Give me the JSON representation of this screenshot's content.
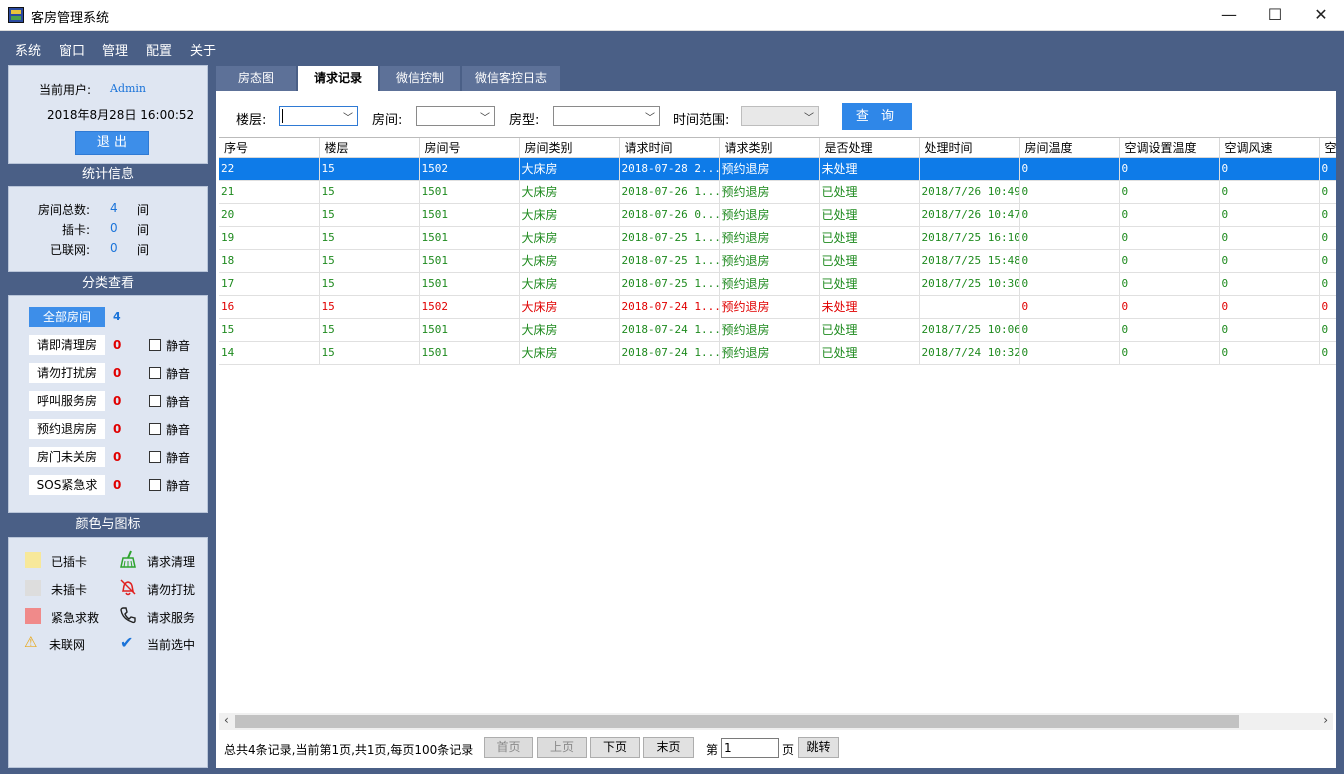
{
  "window": {
    "title": "客房管理系统",
    "minimize": "—",
    "maximize": "☐",
    "close": "✕"
  },
  "menu": [
    "系统",
    "窗口",
    "管理",
    "配置",
    "关于"
  ],
  "user_panel": {
    "label": "当前用户:",
    "user": "Admin",
    "datetime": "2018年8月28日 16:00:52",
    "logout": "退 出"
  },
  "stats": {
    "header": "统计信息",
    "rows": [
      {
        "label": "房间总数:",
        "value": "4",
        "unit": "间"
      },
      {
        "label": "插卡:",
        "value": "0",
        "unit": "间"
      },
      {
        "label": "已联网:",
        "value": "0",
        "unit": "间"
      }
    ]
  },
  "categories": {
    "header": "分类查看",
    "all": {
      "label": "全部房间",
      "count": "4"
    },
    "items": [
      {
        "label": "请即清理房",
        "count": "0",
        "mute": "静音"
      },
      {
        "label": "请勿打扰房",
        "count": "0",
        "mute": "静音"
      },
      {
        "label": "呼叫服务房",
        "count": "0",
        "mute": "静音"
      },
      {
        "label": "预约退房房",
        "count": "0",
        "mute": "静音"
      },
      {
        "label": "房门未关房",
        "count": "0",
        "mute": "静音"
      },
      {
        "label": "SOS紧急求",
        "count": "0",
        "mute": "静音"
      }
    ]
  },
  "legend": {
    "header": "颜色与图标",
    "left": [
      "已插卡",
      "未插卡",
      "紧急求救",
      "未联网"
    ],
    "right": [
      "请求清理",
      "请勿打扰",
      "请求服务",
      "当前选中"
    ],
    "colors": {
      "inserted": "#f7e89a",
      "not_inserted": "#dddddd",
      "emergency": "#f08a8a"
    }
  },
  "tabs": [
    "房态图",
    "请求记录",
    "微信控制",
    "微信客控日志"
  ],
  "filters": {
    "floor": "楼层:",
    "room": "房间:",
    "room_type": "房型:",
    "time_range": "时间范围:",
    "query": "查 询"
  },
  "table": {
    "columns": [
      "序号",
      "楼层",
      "房间号",
      "房间类别",
      "请求时间",
      "请求类别",
      "是否处理",
      "处理时间",
      "房间温度",
      "空调设置温度",
      "空调风速",
      "空"
    ],
    "rows": [
      [
        "22",
        "15",
        "1502",
        "大床房",
        "2018-07-28 2...",
        "预约退房",
        "未处理",
        "",
        "0",
        "0",
        "0",
        "0"
      ],
      [
        "21",
        "15",
        "1501",
        "大床房",
        "2018-07-26 1...",
        "预约退房",
        "已处理",
        "2018/7/26 10:49",
        "0",
        "0",
        "0",
        "0"
      ],
      [
        "20",
        "15",
        "1501",
        "大床房",
        "2018-07-26 0...",
        "预约退房",
        "已处理",
        "2018/7/26 10:47",
        "0",
        "0",
        "0",
        "0"
      ],
      [
        "19",
        "15",
        "1501",
        "大床房",
        "2018-07-25 1...",
        "预约退房",
        "已处理",
        "2018/7/25 16:10",
        "0",
        "0",
        "0",
        "0"
      ],
      [
        "18",
        "15",
        "1501",
        "大床房",
        "2018-07-25 1...",
        "预约退房",
        "已处理",
        "2018/7/25 15:48",
        "0",
        "0",
        "0",
        "0"
      ],
      [
        "17",
        "15",
        "1501",
        "大床房",
        "2018-07-25 1...",
        "预约退房",
        "已处理",
        "2018/7/25 10:30",
        "0",
        "0",
        "0",
        "0"
      ],
      [
        "16",
        "15",
        "1502",
        "大床房",
        "2018-07-24 1...",
        "预约退房",
        "未处理",
        "",
        "0",
        "0",
        "0",
        "0"
      ],
      [
        "15",
        "15",
        "1501",
        "大床房",
        "2018-07-24 1...",
        "预约退房",
        "已处理",
        "2018/7/25 10:06",
        "0",
        "0",
        "0",
        "0"
      ],
      [
        "14",
        "15",
        "1501",
        "大床房",
        "2018-07-24 1...",
        "预约退房",
        "已处理",
        "2018/7/24 10:32",
        "0",
        "0",
        "0",
        "0"
      ]
    ]
  },
  "pagination": {
    "summary": "总共4条记录,当前第1页,共1页,每页100条记录",
    "first": "首页",
    "prev": "上页",
    "next": "下页",
    "last": "末页",
    "page_prefix": "第",
    "page_value": "1",
    "page_suffix": "页",
    "jump": "跳转"
  }
}
